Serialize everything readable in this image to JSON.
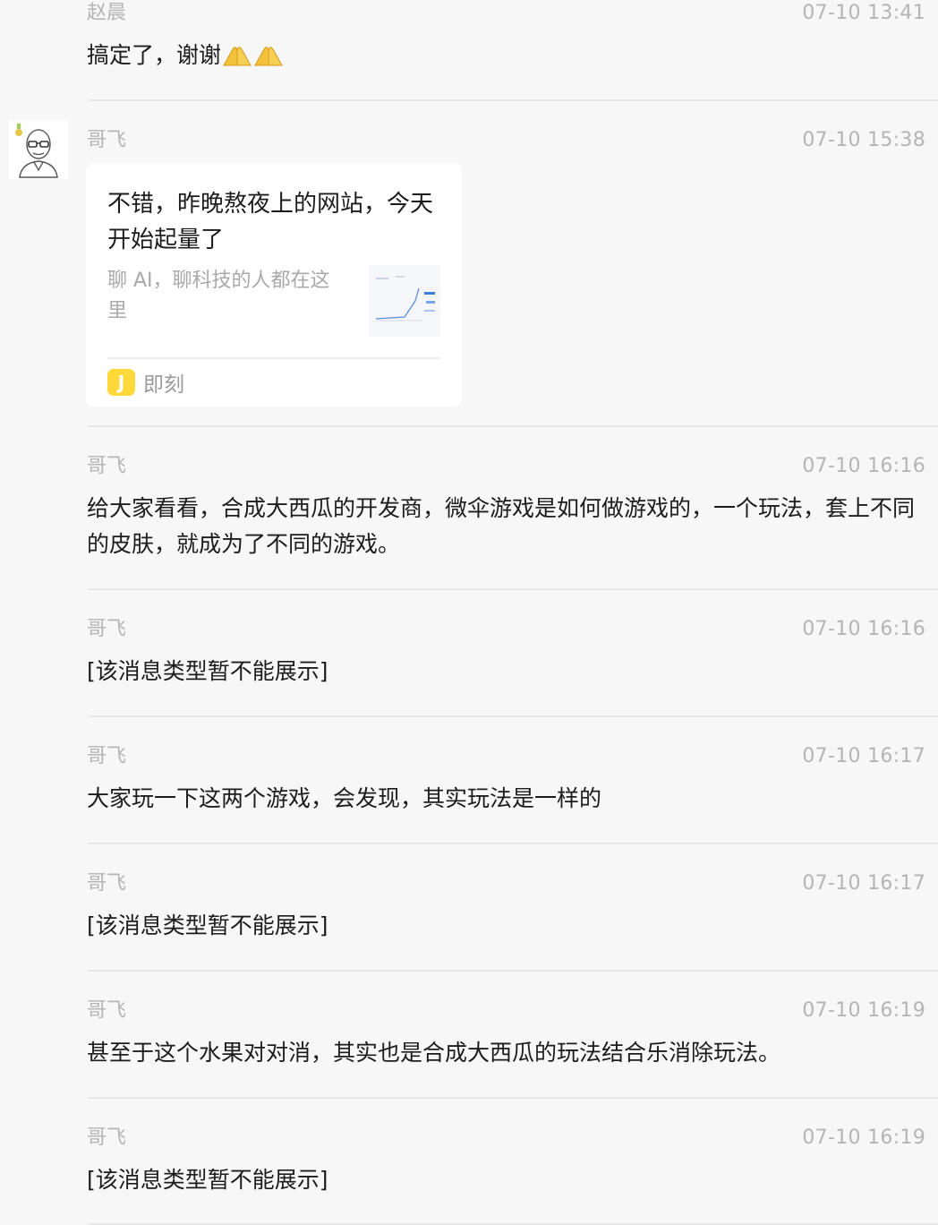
{
  "messages": [
    {
      "sender": "赵晨",
      "time": "07-10 13:41",
      "text": "搞定了，谢谢",
      "emoji": [
        "pray-hands-icon",
        "pray-hands-icon"
      ]
    },
    {
      "sender": "哥飞",
      "time": "07-10 15:38",
      "card": {
        "title": "不错，昨晚熬夜上的网站，今天开始起量了",
        "description": "聊 AI，聊科技的人都在这里",
        "source_logo": "J",
        "source_name": "即刻",
        "accent_color": "#ffd83a"
      }
    },
    {
      "sender": "哥飞",
      "time": "07-10 16:16",
      "text": "给大家看看，合成大西瓜的开发商，微伞游戏是如何做游戏的，一个玩法，套上不同的皮肤，就成为了不同的游戏。"
    },
    {
      "sender": "哥飞",
      "time": "07-10 16:16",
      "text": "[该消息类型暂不能展示]"
    },
    {
      "sender": "哥飞",
      "time": "07-10 16:17",
      "text": "大家玩一下这两个游戏，会发现，其实玩法是一样的"
    },
    {
      "sender": "哥飞",
      "time": "07-10 16:17",
      "text": "[该消息类型暂不能展示]"
    },
    {
      "sender": "哥飞",
      "time": "07-10 16:19",
      "text": "甚至于这个水果对对消，其实也是合成大西瓜的玩法结合乐消除玩法。"
    },
    {
      "sender": "哥飞",
      "time": "07-10 16:19",
      "text": "[该消息类型暂不能展示]"
    }
  ]
}
